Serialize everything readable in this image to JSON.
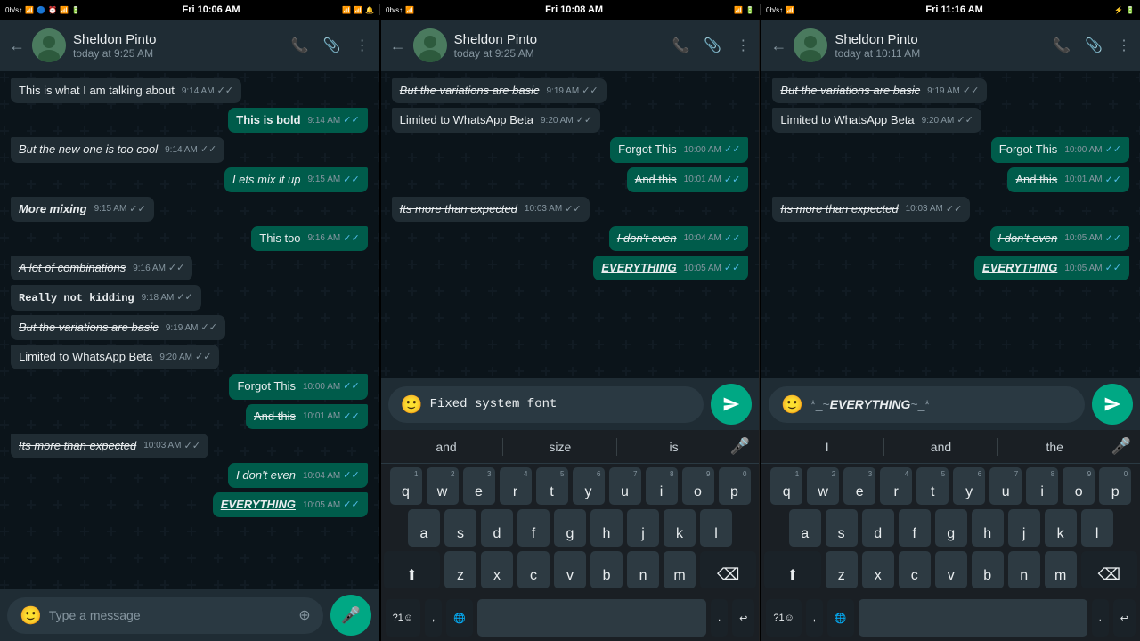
{
  "statusBars": [
    {
      "left": "0b/s↑",
      "time": "Fri 10:06 AM",
      "icons": "📶🔵🔔📶🔋"
    },
    {
      "left": "0b/s↑",
      "time": "Fri 10:08 AM",
      "icons": "📶🔵🔔📶🔋"
    },
    {
      "left": "0b/s↑",
      "time": "Fri 11:16 AM",
      "icons": "📶🔵🔔📶🔋"
    }
  ],
  "panels": [
    {
      "id": "panel1",
      "header": {
        "name": "Sheldon Pinto",
        "status": "today at 9:25 AM"
      },
      "messages": [
        {
          "id": 1,
          "text": "This is what I am talking about",
          "time": "9:14 AM",
          "type": "received",
          "format": "normal"
        },
        {
          "id": 2,
          "text": "This is bold",
          "time": "9:14 AM",
          "type": "sent",
          "format": "bold"
        },
        {
          "id": 3,
          "text": "But the new one is too cool",
          "time": "9:14 AM",
          "type": "received",
          "format": "italic"
        },
        {
          "id": 4,
          "text": "Lets mix it up",
          "time": "9:15 AM",
          "type": "sent",
          "format": "italic"
        },
        {
          "id": 5,
          "text": "More mixing",
          "time": "9:15 AM",
          "type": "received",
          "format": "bold-italic"
        },
        {
          "id": 6,
          "text": "This too",
          "time": "9:16 AM",
          "type": "sent",
          "format": "normal"
        },
        {
          "id": 7,
          "text": "A lot of combinations",
          "time": "9:16 AM",
          "type": "received",
          "format": "strikethrough-italic"
        },
        {
          "id": 8,
          "text": "Really not kidding",
          "time": "9:18 AM",
          "type": "received",
          "format": "mono-bold"
        },
        {
          "id": 9,
          "text": "But the variations are basic",
          "time": "9:19 AM",
          "type": "received",
          "format": "strikethrough-italic"
        },
        {
          "id": 10,
          "text": "Limited to WhatsApp Beta",
          "time": "9:20 AM",
          "type": "received",
          "format": "normal"
        },
        {
          "id": 11,
          "text": "Forgot This",
          "time": "10:00 AM",
          "type": "sent",
          "format": "normal"
        },
        {
          "id": 12,
          "text": "And this",
          "time": "10:01 AM",
          "type": "sent",
          "format": "strikethrough"
        },
        {
          "id": 13,
          "text": "Its more than expected",
          "time": "10:03 AM",
          "type": "received",
          "format": "strikethrough-italic"
        },
        {
          "id": 14,
          "text": "I don't even",
          "time": "10:04 AM",
          "type": "sent",
          "format": "strikethrough-italic"
        },
        {
          "id": 15,
          "text": "EVERYTHING",
          "time": "10:05 AM",
          "type": "sent",
          "format": "bold-italic-underline"
        }
      ],
      "input": {
        "placeholder": "Type a message",
        "hasText": false
      },
      "hasKeyboard": false
    },
    {
      "id": "panel2",
      "header": {
        "name": "Sheldon Pinto",
        "status": "today at 9:25 AM"
      },
      "messages": [
        {
          "id": 1,
          "text": "But the variations are basic",
          "time": "9:19 AM",
          "type": "received",
          "format": "strikethrough-italic"
        },
        {
          "id": 2,
          "text": "Limited to WhatsApp Beta",
          "time": "9:20 AM",
          "type": "received",
          "format": "normal"
        },
        {
          "id": 3,
          "text": "Forgot This",
          "time": "10:00 AM",
          "type": "sent",
          "format": "normal"
        },
        {
          "id": 4,
          "text": "And this",
          "time": "10:01 AM",
          "type": "sent",
          "format": "strikethrough"
        },
        {
          "id": 5,
          "text": "Its more than expected",
          "time": "10:03 AM",
          "type": "received",
          "format": "strikethrough-italic"
        },
        {
          "id": 6,
          "text": "I don't even",
          "time": "10:04 AM",
          "type": "sent",
          "format": "strikethrough-italic"
        },
        {
          "id": 7,
          "text": "EVERYTHING",
          "time": "10:05 AM",
          "type": "sent",
          "format": "bold-italic-underline"
        }
      ],
      "input": {
        "value": "Fixed system font",
        "hasText": true,
        "format": "mono"
      },
      "hasKeyboard": true,
      "suggestions": [
        "and",
        "size",
        "is"
      ],
      "keyRows": [
        [
          "q",
          "w",
          "e",
          "r",
          "t",
          "y",
          "u",
          "i",
          "o",
          "p"
        ],
        [
          "a",
          "s",
          "d",
          "f",
          "g",
          "h",
          "j",
          "k",
          "l"
        ],
        [
          "z",
          "x",
          "c",
          "v",
          "b",
          "n",
          "m"
        ]
      ],
      "keyNums": [
        "1",
        "2",
        "3",
        "4",
        "5",
        "6",
        "7",
        "8",
        "9",
        "0"
      ]
    },
    {
      "id": "panel3",
      "header": {
        "name": "Sheldon Pinto",
        "status": "today at 10:11 AM"
      },
      "messages": [
        {
          "id": 1,
          "text": "But the variations are basic",
          "time": "9:19 AM",
          "type": "received",
          "format": "strikethrough-italic"
        },
        {
          "id": 2,
          "text": "Limited to WhatsApp Beta",
          "time": "9:20 AM",
          "type": "received",
          "format": "normal"
        },
        {
          "id": 3,
          "text": "Forgot This",
          "time": "10:00 AM",
          "type": "sent",
          "format": "normal"
        },
        {
          "id": 4,
          "text": "And this",
          "time": "10:01 AM",
          "type": "sent",
          "format": "strikethrough"
        },
        {
          "id": 5,
          "text": "Its more than expected",
          "time": "10:03 AM",
          "type": "received",
          "format": "strikethrough-italic"
        },
        {
          "id": 6,
          "text": "I don't even",
          "time": "10:05 AM",
          "type": "sent",
          "format": "strikethrough-italic"
        },
        {
          "id": 7,
          "text": "EVERYTHING",
          "time": "10:05 AM",
          "type": "sent",
          "format": "bold-italic-underline"
        }
      ],
      "input": {
        "value": "*_~EVERYTHING~_*",
        "hasText": true,
        "format": "everything"
      },
      "hasKeyboard": true,
      "suggestions": [
        "I",
        "and",
        "the"
      ],
      "keyRows": [
        [
          "q",
          "w",
          "e",
          "r",
          "t",
          "y",
          "u",
          "i",
          "o",
          "p"
        ],
        [
          "a",
          "s",
          "d",
          "f",
          "g",
          "h",
          "j",
          "k",
          "l"
        ],
        [
          "z",
          "x",
          "c",
          "v",
          "b",
          "n",
          "m"
        ]
      ],
      "keyNums": [
        "1",
        "2",
        "3",
        "4",
        "5",
        "6",
        "7",
        "8",
        "9",
        "0"
      ]
    }
  ],
  "colors": {
    "sentBubble": "#005c4b",
    "receivedBubble": "#202c33",
    "headerBg": "#1f2c34",
    "chatBg": "#0b141a",
    "sendBtn": "#00a884",
    "inputBg": "#2a3942"
  },
  "icons": {
    "back": "←",
    "phone": "📞",
    "video": "📹",
    "more": "⋮",
    "emoji": "🙂",
    "camera": "📷",
    "mic": "🎤",
    "send": "➤",
    "attachment": "📎",
    "check": "✓",
    "doubleCheck": "✓✓"
  }
}
